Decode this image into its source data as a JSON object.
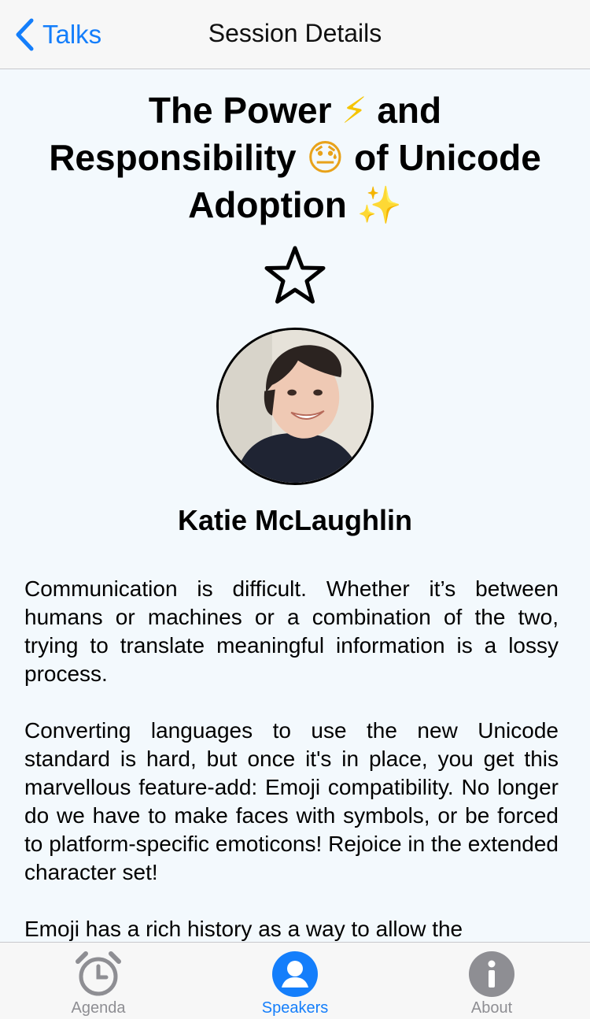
{
  "navbar": {
    "back_label": "Talks",
    "title": "Session Details"
  },
  "session": {
    "title_part1": "The Power ",
    "emoji1": "⚡",
    "title_part2": " and Responsibility ",
    "emoji2": "😓",
    "title_part3": " of Unicode Adoption ",
    "emoji3": "✨",
    "favorited": false,
    "speaker_name": "Katie McLaughlin",
    "description": [
      "Communication is difficult. Whether it’s between humans or machines or a combination of the two, trying to translate meaningful information is a lossy process.",
      "Converting languages to use the new Unicode standard is hard, but once it's in place, you get this marvellous feature-add: Emoji compatibility. No longer do we have to make faces with symbols, or be forced to platform-specific emoticons! Rejoice in the extended character set!",
      "Emoji has a rich history as a way to allow the"
    ]
  },
  "tabbar": {
    "tabs": [
      {
        "label": "Agenda",
        "icon": "alarm-clock-icon",
        "active": false
      },
      {
        "label": "Speakers",
        "icon": "person-icon",
        "active": true
      },
      {
        "label": "About",
        "icon": "info-icon",
        "active": false
      }
    ]
  },
  "colors": {
    "accent": "#147efb",
    "inactive": "#8e8e93",
    "background": "#f3f9fd"
  }
}
